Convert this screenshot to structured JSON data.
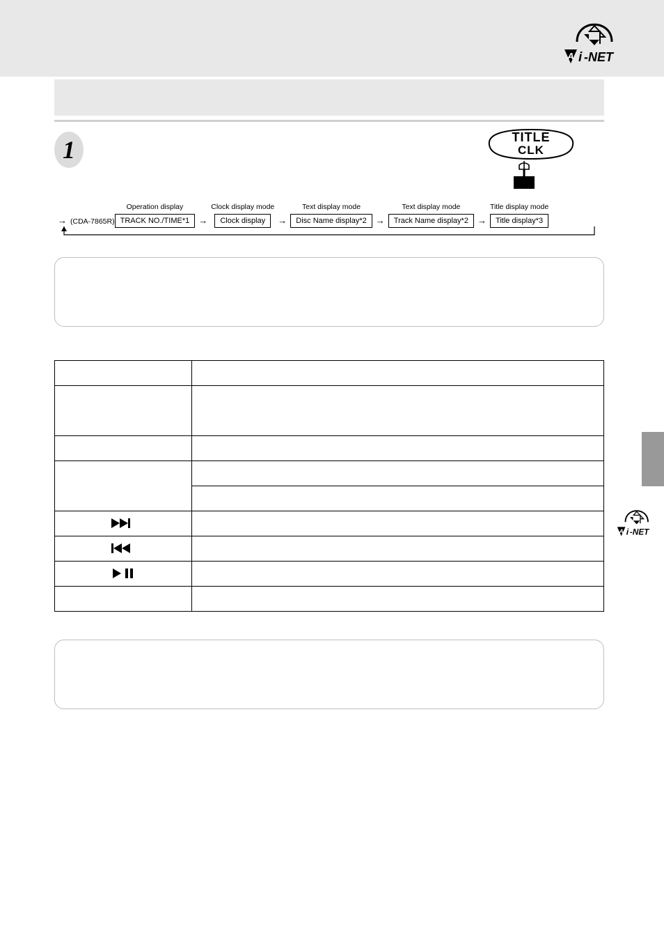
{
  "logo_text": "-NET",
  "step": {
    "number": "1",
    "button_line1": "TITLE",
    "button_line2": "CLK"
  },
  "flow": {
    "lead_model": "(CDA-7865R)",
    "cols": [
      {
        "label": "Operation display",
        "box": "TRACK NO./TIME*1"
      },
      {
        "label": "Clock display mode",
        "box": "Clock display"
      },
      {
        "label": "Text display mode",
        "box": "Disc Name display*2"
      },
      {
        "label": "Text display mode",
        "box": "Track Name display*2"
      },
      {
        "label": "Title display mode",
        "box": "Title display*3"
      }
    ]
  },
  "icons": {
    "ffwd_name": "forward-skip-icon",
    "rwd_name": "rewind-skip-icon",
    "play_name": "play-pause-icon"
  }
}
